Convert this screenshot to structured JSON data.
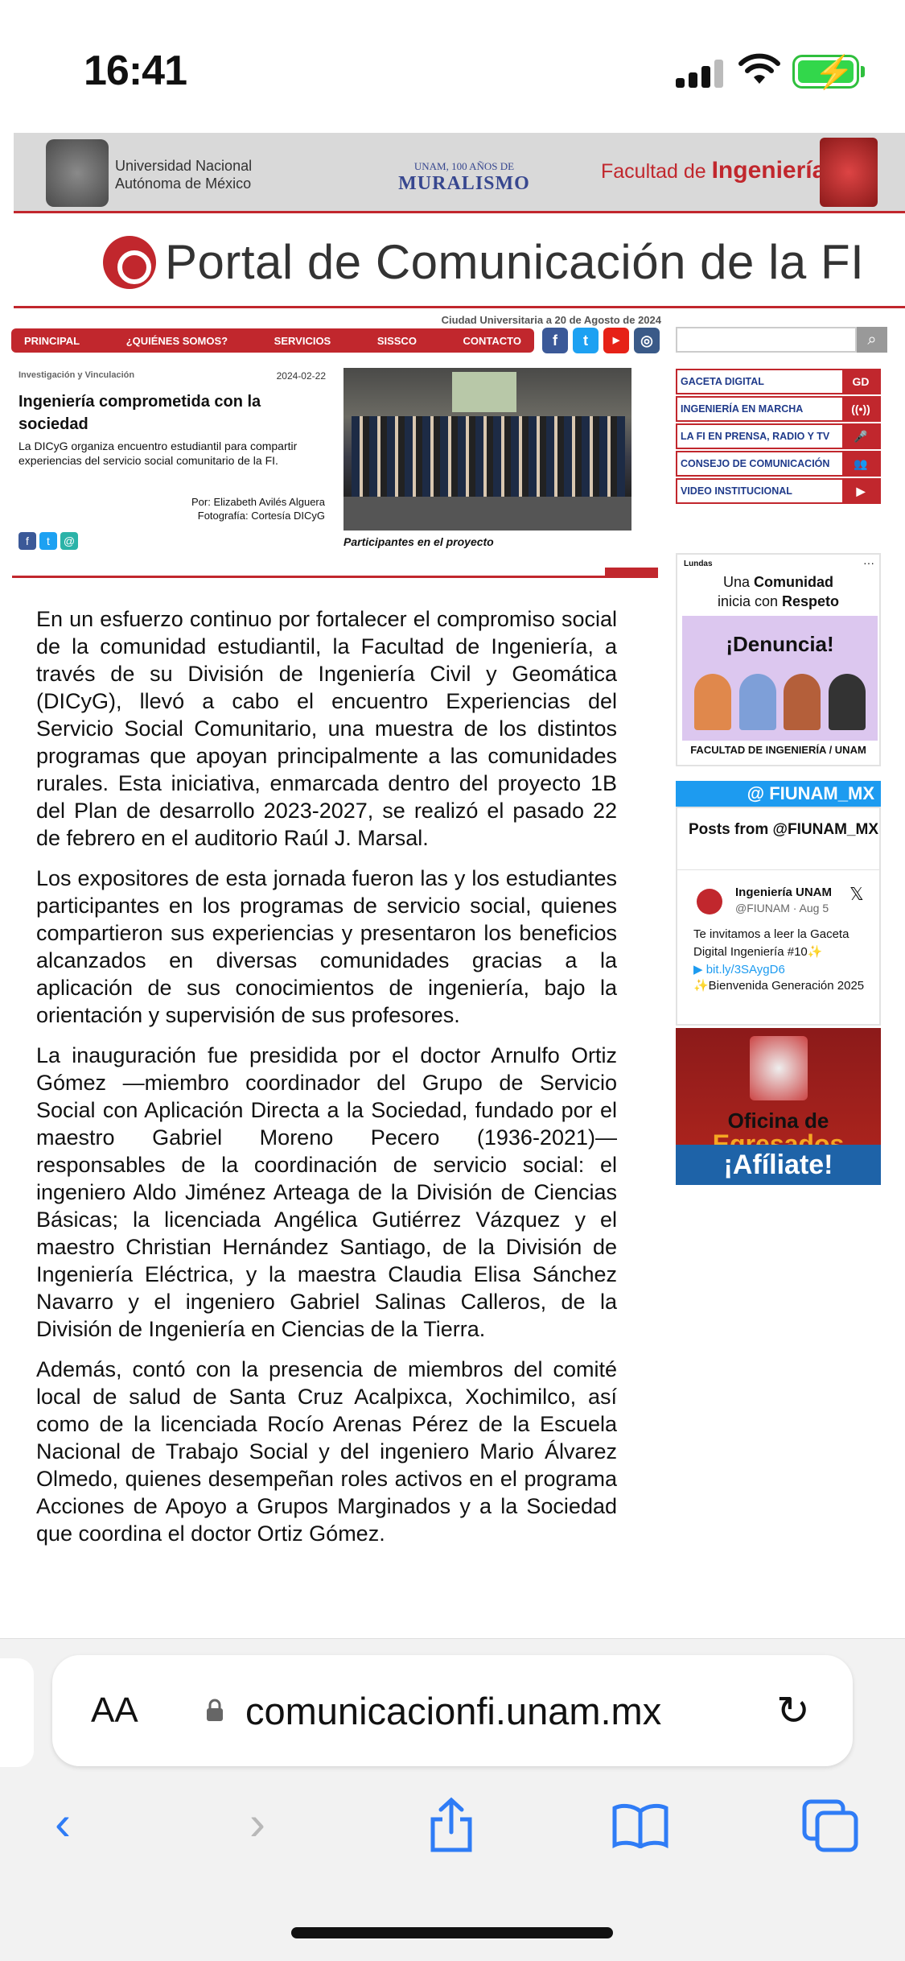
{
  "status": {
    "time": "16:41"
  },
  "header": {
    "unam_line1": "Universidad Nacional",
    "unam_line2": "Autónoma de México",
    "mural_line1": "UNAM, 100 AÑOS DE",
    "mural_line2": "MURALISMO",
    "fi_prefix": "Facultad de ",
    "fi_name": "Ingeniería",
    "portal_title": "Portal de Comunicación de la FI",
    "dateline": "Ciudad Universitaria a 20 de Agosto de 2024"
  },
  "nav": {
    "items": [
      "PRINCIPAL",
      "¿QUIÉNES SOMOS?",
      "SERVICIOS",
      "SISSCO",
      "CONTACTO"
    ],
    "search_placeholder": ""
  },
  "article": {
    "section": "Investigación y Vinculación",
    "date": "2024-02-22",
    "title": "Ingeniería comprometida con la sociedad",
    "summary": "La DICyG organiza encuentro estudiantil para compartir experiencias del servicio social comunitario de la FI.",
    "author": "Por: Elizabeth Avilés Alguera",
    "photo_credit": "Fotografía: Cortesía DICyG",
    "caption": "Participantes en el proyecto",
    "paragraphs": [
      "En un esfuerzo continuo por fortalecer el compromiso social de la comunidad estudiantil, la Facultad de Ingeniería, a través de su División de Ingeniería Civil y Geomática (DICyG), llevó a cabo el encuentro Experiencias del Servicio Social Comunitario, una muestra de los distintos programas que apoyan principalmente a las comunidades rurales. Esta iniciativa, enmarcada dentro del proyecto 1B del Plan de desarrollo 2023-2027, se realizó el pasado 22 de febrero en el auditorio Raúl J. Marsal.",
      "Los expositores de esta jornada fueron las y los estudiantes participantes en los programas de servicio social, quienes compartieron sus experiencias y presentaron los beneficios alcanzados en diversas comunidades gracias a la aplicación de sus conocimientos de ingeniería, bajo la orientación y supervisión de sus profesores.",
      "La inauguración fue presidida por el doctor Arnulfo Ortiz Gómez —miembro coordinador del Grupo de Servicio Social con Aplicación Directa a la Sociedad, fundado por el maestro Gabriel Moreno Pecero (1936-2021)— responsables de la coordinación de servicio social: el ingeniero Aldo Jiménez Arteaga de la División de Ciencias Básicas; la licenciada Angélica Gutiérrez Vázquez y el maestro Christian Hernández Santiago, de la División de Ingeniería Eléctrica, y la maestra Claudia Elisa Sánchez Navarro y el ingeniero Gabriel Salinas Calleros, de la División de Ingeniería en Ciencias de la Tierra.",
      "Además, contó con la presencia de miembros del comité local de salud de Santa Cruz Acalpixca, Xochimilco, así como de la licenciada Rocío Arenas Pérez de la Escuela Nacional de Trabajo Social y del ingeniero Mario Álvarez Olmedo, quienes desempeñan roles activos en el programa Acciones de Apoyo a Grupos Marginados y a la Sociedad que coordina el doctor Ortiz Gómez."
    ]
  },
  "sidebar": {
    "links": [
      {
        "label": "GACETA DIGITAL",
        "icon": "GD"
      },
      {
        "label": "INGENIERÍA EN MARCHA",
        "icon": "((•))"
      },
      {
        "label": "LA FI EN PRENSA, RADIO Y TV",
        "icon": "🎤"
      },
      {
        "label": "CONSEJO DE COMUNICACIÓN",
        "icon": "👥"
      },
      {
        "label": "VIDEO INSTITUCIONAL",
        "icon": "▶"
      }
    ],
    "lundas": {
      "brand": "Lundas",
      "line1_a": "Una ",
      "line1_b": "Comunidad",
      "line2_a": "inicia con ",
      "line2_b": "Respeto",
      "headline": "¡Denuncia!",
      "footer": "FACULTAD DE INGENIERÍA / UNAM"
    },
    "twitter": {
      "banner": "@ FIUNAM_MX",
      "title": "Posts from @FIUNAM_MX",
      "name": "Ingeniería UNAM",
      "handle": "@FIUNAM · Aug 5",
      "text": "Te invitamos a leer la Gaceta Digital Ingeniería #10✨",
      "link": "▶ bit.ly/3SAygD6",
      "text2": "✨Bienvenida Generación 2025"
    },
    "egresados": {
      "line1": "Oficina de",
      "line2": "Egresados",
      "cta": "¡Afíliate!"
    }
  },
  "browser": {
    "aa": "AA",
    "url": "comunicacionfi.unam.mx"
  },
  "colors": {
    "brand_red": "#c1272d",
    "link_blue": "#1f3a8a",
    "ios_blue": "#2f7cf6",
    "twitter": "#1d9bf0"
  }
}
